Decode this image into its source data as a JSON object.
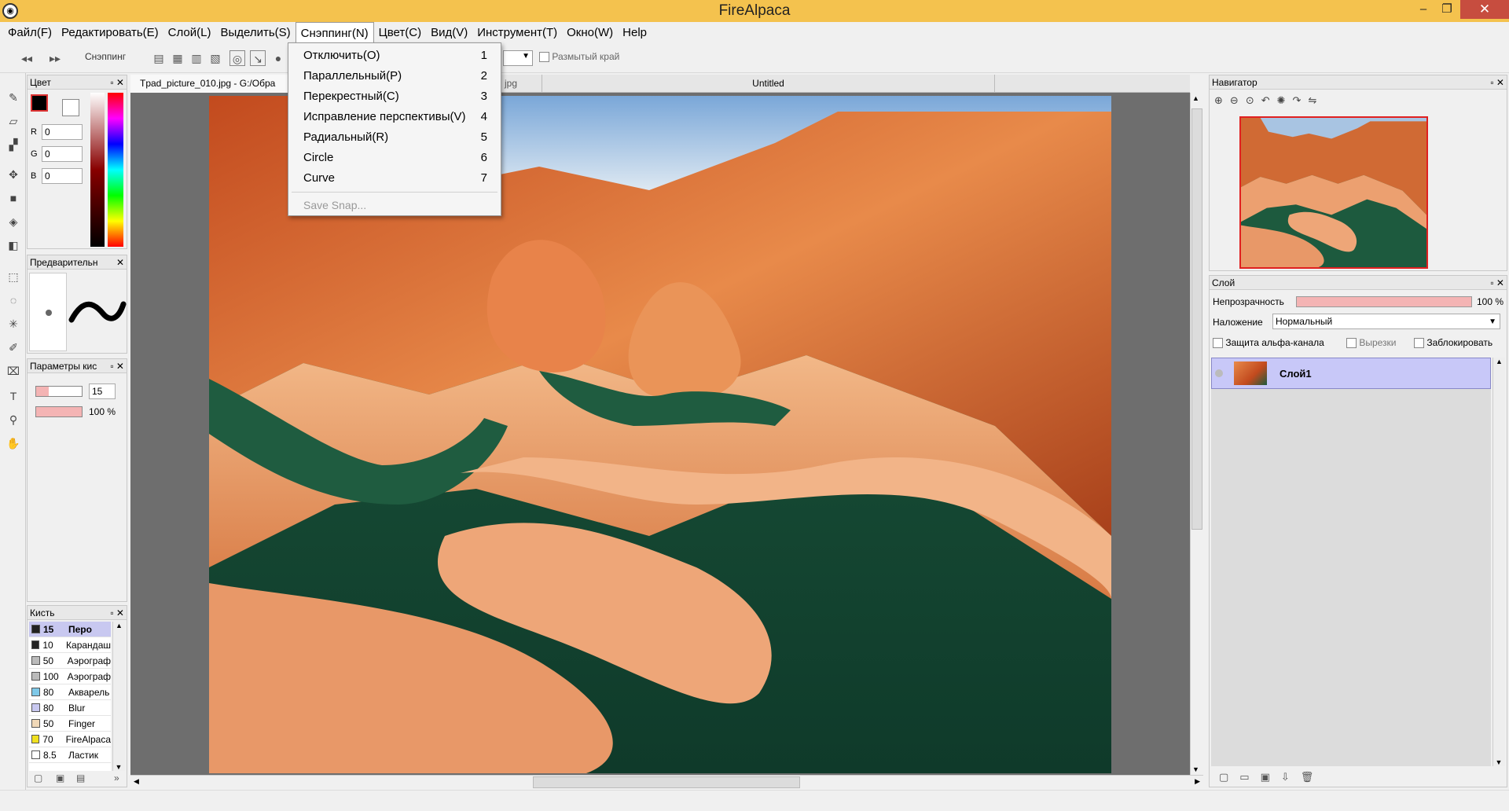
{
  "app": {
    "title": "FireAlpaca"
  },
  "window_controls": {
    "minimize": "–",
    "maximize": "❐",
    "close": "✕"
  },
  "menubar": {
    "items": [
      "Файл(F)",
      "Редактировать(E)",
      "Слой(L)",
      "Выделить(S)",
      "Снэппинг(N)",
      "Цвет(C)",
      "Вид(V)",
      "Инструмент(T)",
      "Окно(W)",
      "Help"
    ]
  },
  "toolbar": {
    "snap_label": "Снэппинг",
    "blur_edge_label": "Размытый край"
  },
  "snap_menu": {
    "items": [
      {
        "label": "Отключить(O)",
        "key": "1"
      },
      {
        "label": "Параллельный(P)",
        "key": "2"
      },
      {
        "label": "Перекрестный(C)",
        "key": "3"
      },
      {
        "label": "Исправление перспективы(V)",
        "key": "4"
      },
      {
        "label": "Радиальный(R)",
        "key": "5"
      },
      {
        "label": "Circle",
        "key": "6"
      },
      {
        "label": "Curve",
        "key": "7"
      }
    ],
    "save_snap": "Save Snap..."
  },
  "tabs": {
    "file_tab": "Tpad_picture_010.jpg - G:/Обра",
    "file_tab_suffix": "jpg",
    "untitled_tab": "Untitled"
  },
  "color_panel": {
    "title": "Цвет",
    "r_label": "R",
    "g_label": "G",
    "b_label": "B",
    "r": "0",
    "g": "0",
    "b": "0"
  },
  "preview_panel": {
    "title": "Предварительн"
  },
  "brush_params_panel": {
    "title": "Параметры кис",
    "size": "15",
    "opacity": "100 %"
  },
  "brush_panel": {
    "title": "Кисть",
    "brushes": [
      {
        "size": "15",
        "name": "Перо",
        "color": "#222222",
        "selected": true
      },
      {
        "size": "10",
        "name": "Карандаш",
        "color": "#222222"
      },
      {
        "size": "50",
        "name": "Аэрограф",
        "color": "#bbbbbb"
      },
      {
        "size": "100",
        "name": "Аэрограф",
        "color": "#bbbbbb"
      },
      {
        "size": "80",
        "name": "Акварель",
        "color": "#7ec8e8"
      },
      {
        "size": "80",
        "name": "Blur",
        "color": "#c8c8f0"
      },
      {
        "size": "50",
        "name": "Finger",
        "color": "#f0d8b8"
      },
      {
        "size": "70",
        "name": "FireAlpaca",
        "color": "#f0e020"
      },
      {
        "size": "8.5",
        "name": "Ластик",
        "color": "#ffffff"
      }
    ]
  },
  "navigator_panel": {
    "title": "Навигатор"
  },
  "layer_panel": {
    "title": "Слой",
    "opacity_label": "Непрозрачность",
    "opacity_value": "100 %",
    "blend_label": "Наложение",
    "blend_value": "Нормальный",
    "alpha_protect": "Защита альфа-канала",
    "clipping": "Вырезки",
    "lock": "Заблокировать",
    "layers": [
      {
        "name": "Слой1"
      }
    ]
  },
  "colors": {
    "title_bar": "#f4c24e",
    "close_button": "#c74d3f",
    "selected_layer": "#c8c8f8",
    "opacity_bar": "#f4b4b4"
  }
}
